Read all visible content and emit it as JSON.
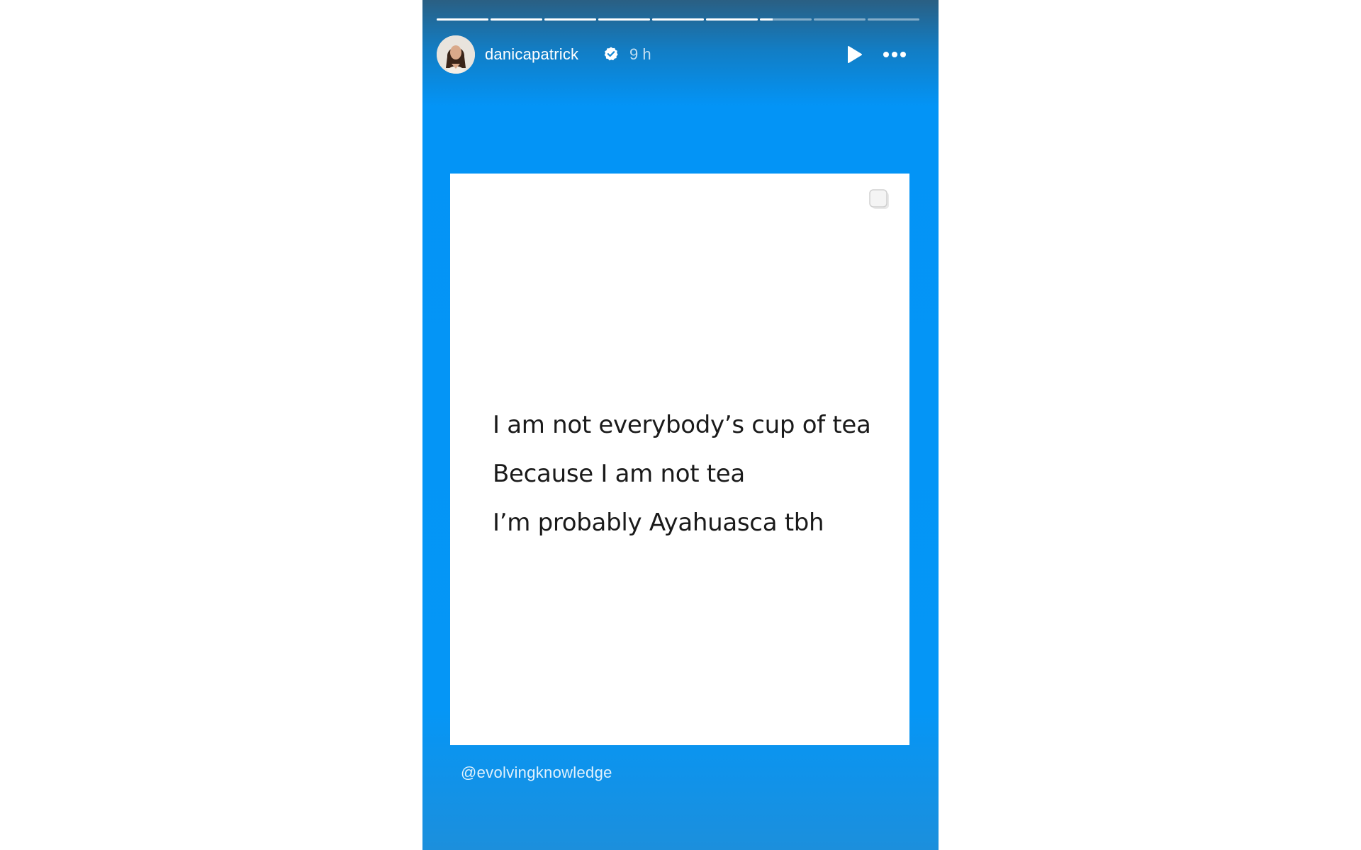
{
  "story": {
    "progress_segments": [
      1,
      1,
      1,
      1,
      1,
      1,
      0.25,
      0,
      0
    ],
    "author": {
      "username": "danicapatrick",
      "verified": true,
      "posted_ago": "9 h"
    },
    "controls": {
      "play_icon": "play-icon",
      "more_icon": "more-options-icon"
    },
    "card": {
      "quote_lines": [
        "I am not everybody’s cup of tea",
        "Because I am not tea",
        "I’m probably  Ayahuasca tbh"
      ],
      "corner_icon": "copy-icon"
    },
    "mention": "@evolvingknowledge"
  },
  "colors": {
    "story_blue": "#0394f6",
    "header_dark": "#2a5f83",
    "card_bg": "#ffffff",
    "text_dark": "#1a1a1a"
  }
}
